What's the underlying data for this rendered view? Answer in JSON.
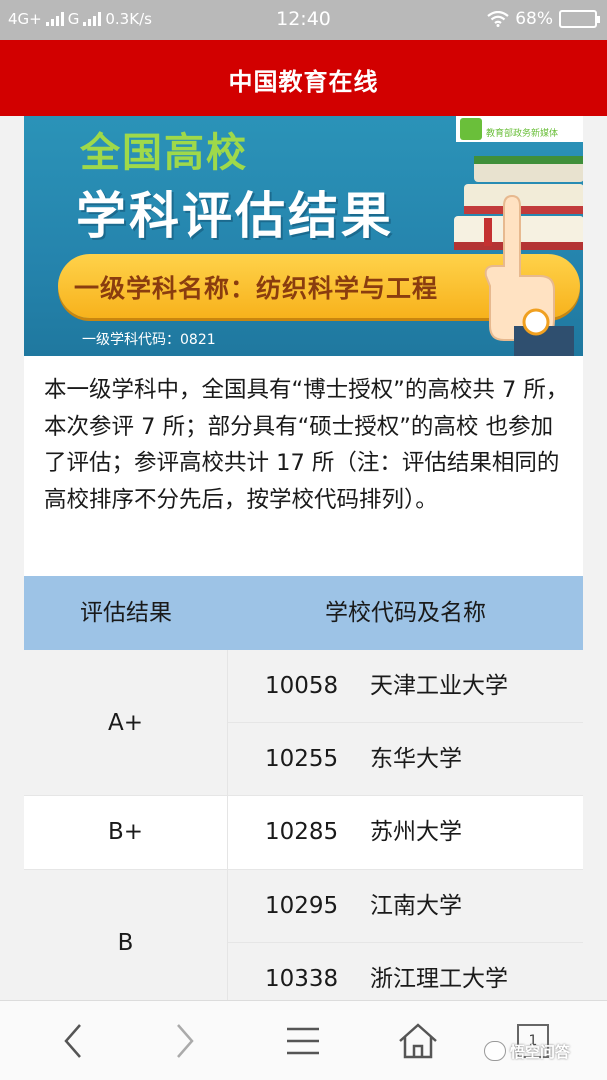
{
  "status_bar": {
    "network_1": "4G+",
    "network_2": "G",
    "speed": "0.3K/s",
    "time": "12:40",
    "battery": "68%"
  },
  "header": {
    "title": "中国教育在线"
  },
  "banner": {
    "line1": "全国高校",
    "line2": "学科评估结果",
    "subject": "一级学科名称：纺织科学与工程",
    "code": "一级学科代码：0821",
    "media_label": "教育部政务新媒体"
  },
  "intro": {
    "text": "本一级学科中，全国具有“博士授权”的高校共 7 所，本次参评 7 所；部分具有“硕士授权”的高校 也参加了评估；参评高校共计 17 所（注：评估结果相同的高校排序不分先后，按学校代码排列）。"
  },
  "table": {
    "headers": [
      "评估结果",
      "学校代码及名称"
    ],
    "groups": [
      {
        "grade": "A+",
        "schools": [
          {
            "code": "10058",
            "name": "天津工业大学"
          },
          {
            "code": "10255",
            "name": "东华大学"
          }
        ]
      },
      {
        "grade": "B+",
        "schools": [
          {
            "code": "10285",
            "name": "苏州大学"
          }
        ]
      },
      {
        "grade": "B",
        "schools": [
          {
            "code": "10295",
            "name": "江南大学"
          },
          {
            "code": "10338",
            "name": "浙江理工大学"
          }
        ]
      }
    ]
  },
  "bottom_nav": {
    "tab_count": "1",
    "watermark": "悟空问答"
  },
  "colors": {
    "header_red": "#d20000",
    "table_header_blue": "#9dc3e6",
    "banner_blue": "#2584ad",
    "banner_green": "#9fd94a",
    "subject_yellow": "#f7b21c"
  },
  "icons": [
    "wifi-icon",
    "battery-icon",
    "back-arrow-icon",
    "forward-arrow-icon",
    "menu-icon",
    "home-icon",
    "tabs-icon"
  ]
}
